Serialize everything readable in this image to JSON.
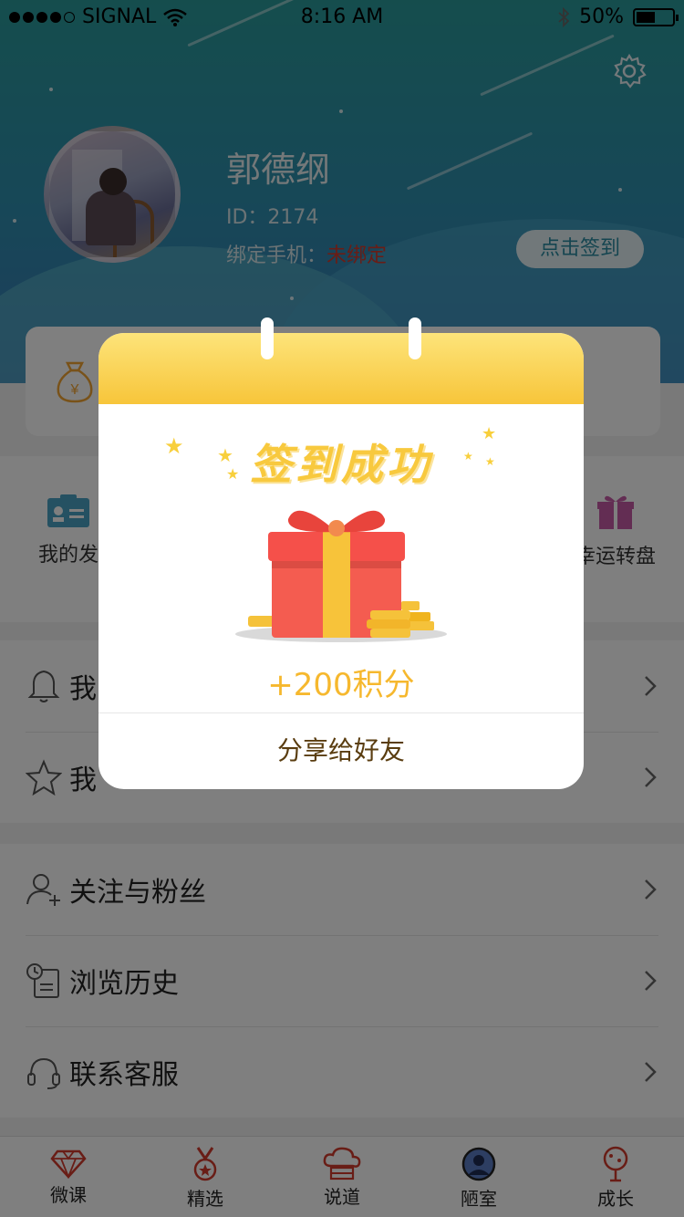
{
  "status_bar": {
    "carrier": "SIGNAL",
    "time": "8:16 AM",
    "battery": "50%"
  },
  "profile": {
    "name": "郭德纲",
    "id_text": "ID：2174",
    "phone_label": "绑定手机：",
    "phone_value": "未绑定",
    "checkin_label": "点击签到"
  },
  "grid": {
    "left_label": "我的发",
    "right_label": "幸运转盘"
  },
  "list_section_1": [
    {
      "label": "我"
    },
    {
      "label": "我"
    }
  ],
  "list_section_2": [
    {
      "label": "关注与粉丝"
    },
    {
      "label": "浏览历史"
    },
    {
      "label": "联系客服"
    }
  ],
  "tabbar": [
    {
      "label": "微课",
      "icon": "diamond-icon"
    },
    {
      "label": "精选",
      "icon": "medal-icon"
    },
    {
      "label": "说道",
      "icon": "cloud-icon"
    },
    {
      "label": "陋室",
      "icon": "user-icon"
    },
    {
      "label": "成长",
      "icon": "tree-icon"
    }
  ],
  "modal": {
    "title": "签到成功",
    "points": "+200积分",
    "share_label": "分享给好友"
  },
  "colors": {
    "accent_yellow": "#f8c93e",
    "tab_red": "#d23a2c",
    "header_teal": "#2a9b9b"
  }
}
